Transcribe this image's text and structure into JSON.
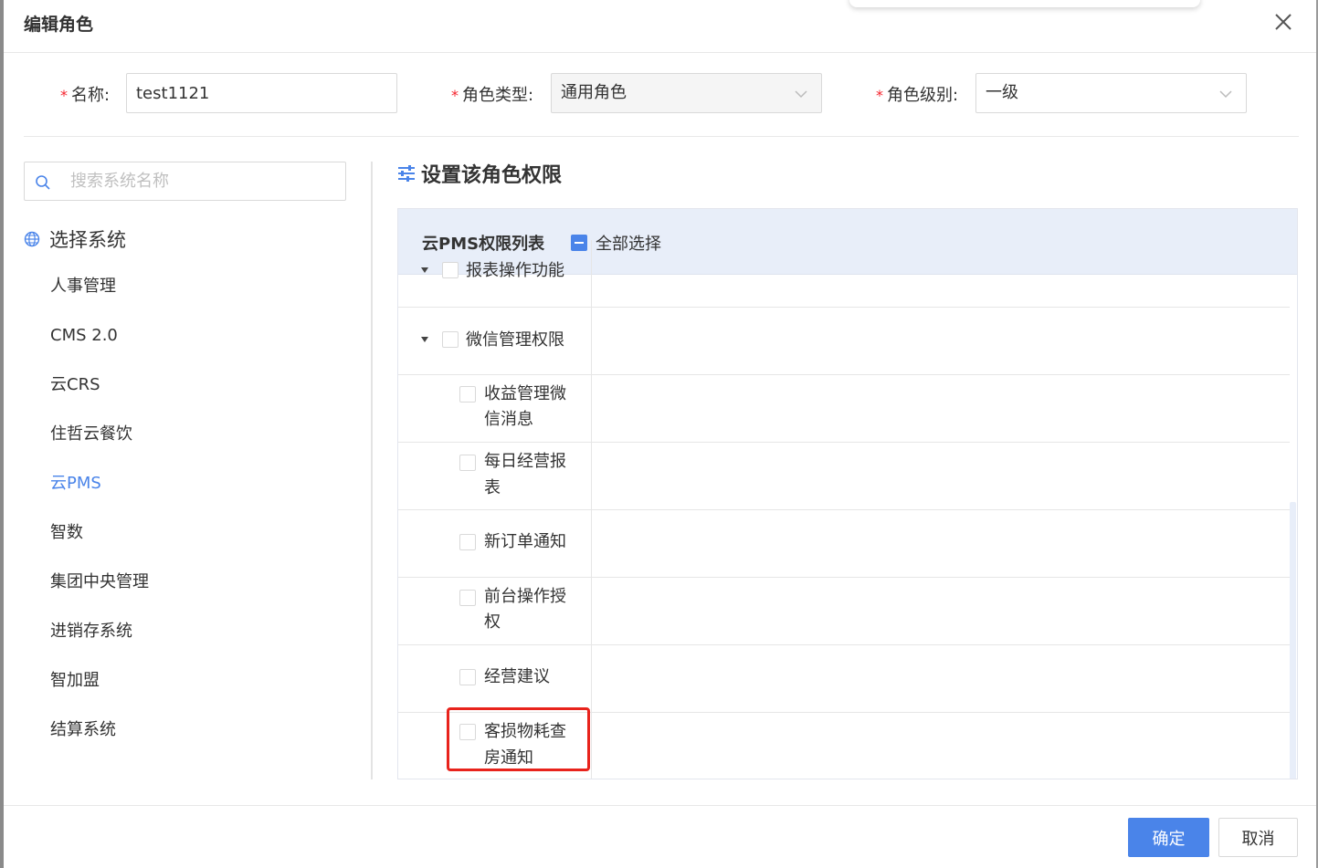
{
  "dialog": {
    "title": "编辑角色"
  },
  "form": {
    "name": {
      "label": "名称:",
      "required_mark": "*",
      "value": "test1121"
    },
    "role_type": {
      "label": "角色类型:",
      "required_mark": "*",
      "value": "通用角色"
    },
    "role_level": {
      "label": "角色级别:",
      "required_mark": "*",
      "value": "一级"
    }
  },
  "sidebar": {
    "search_placeholder": "搜索系统名称",
    "heading": "选择系统",
    "items": [
      {
        "label": "人事管理"
      },
      {
        "label": "CMS 2.0"
      },
      {
        "label": "云CRS"
      },
      {
        "label": "住哲云餐饮"
      },
      {
        "label": "云PMS",
        "active": true
      },
      {
        "label": "智数"
      },
      {
        "label": "集团中央管理"
      },
      {
        "label": "进销存系统"
      },
      {
        "label": "智加盟"
      },
      {
        "label": "结算系统"
      }
    ]
  },
  "permissions": {
    "title": "设置该角色权限",
    "table_title": "云PMS权限列表",
    "select_all_label": "全部选择",
    "partial_row": "报表操作功能",
    "group": "微信管理权限",
    "items": [
      {
        "line1": "收益管理微",
        "line2": "信消息"
      },
      {
        "line1": "每日经营报",
        "line2": "表"
      },
      {
        "line1": "新订单通知",
        "line2": ""
      },
      {
        "line1": "前台操作授",
        "line2": "权"
      },
      {
        "line1": "经营建议",
        "line2": ""
      },
      {
        "line1": "客损物耗查",
        "line2": "房通知",
        "highlighted": true
      }
    ]
  },
  "footer": {
    "ok_label": "确定",
    "cancel_label": "取消"
  },
  "colors": {
    "accent": "#4a84e9",
    "required": "#f5222d",
    "highlight": "#e8231c"
  }
}
